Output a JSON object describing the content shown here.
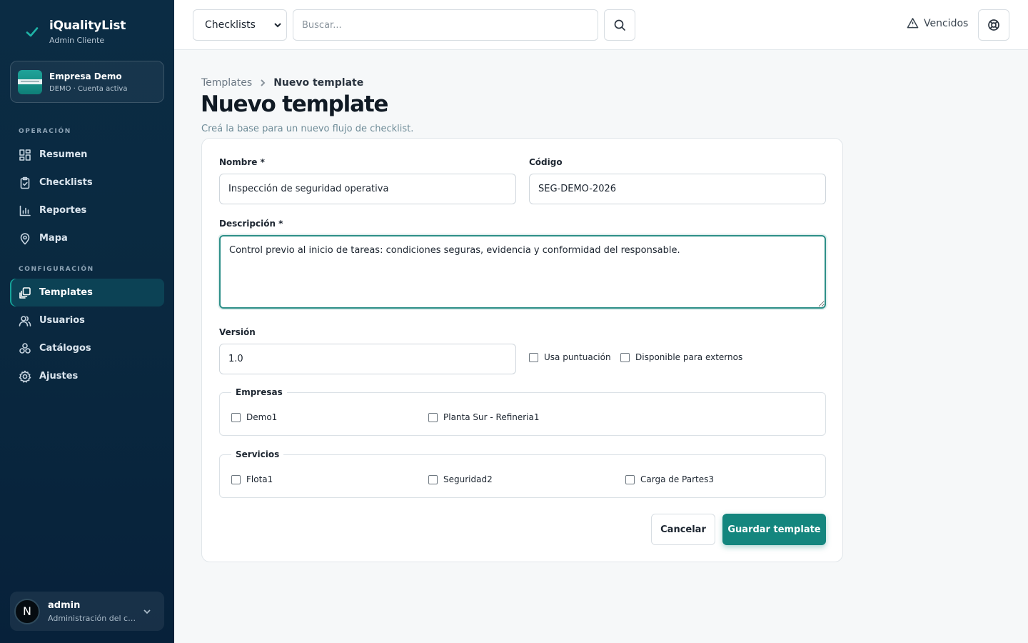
{
  "brand": {
    "title": "iQualityList",
    "subtitle": "Admin Cliente"
  },
  "company": {
    "name": "Empresa Demo",
    "status": "DEMO · Cuenta activa"
  },
  "sidebar": {
    "sections": [
      {
        "label": "OPERACIÓN",
        "items": [
          {
            "label": "Resumen",
            "icon": "grid-icon"
          },
          {
            "label": "Checklists",
            "icon": "clipboard-check-icon"
          },
          {
            "label": "Reportes",
            "icon": "bar-chart-icon"
          },
          {
            "label": "Mapa",
            "icon": "map-pin-icon"
          }
        ]
      },
      {
        "label": "CONFIGURACIÓN",
        "items": [
          {
            "label": "Templates",
            "icon": "templates-icon",
            "active": true
          },
          {
            "label": "Usuarios",
            "icon": "users-icon"
          },
          {
            "label": "Catálogos",
            "icon": "catalog-icon"
          },
          {
            "label": "Ajustes",
            "icon": "gear-icon"
          }
        ]
      }
    ]
  },
  "user": {
    "initial": "N",
    "name": "admin",
    "role": "Administración del cliente"
  },
  "topbar": {
    "select_value": "Checklists",
    "search_placeholder": "Buscar...",
    "overdue_label": "Vencidos"
  },
  "breadcrumb": {
    "parent": "Templates",
    "current": "Nuevo template"
  },
  "page": {
    "title": "Nuevo template",
    "subtitle": "Creá la base para un nuevo flujo de checklist."
  },
  "form": {
    "name_label": "Nombre *",
    "name_value": "Inspección de seguridad operativa",
    "code_label": "Código",
    "code_value": "SEG-DEMO-2026",
    "description_label": "Descripción *",
    "description_value": "Control previo al inicio de tareas: condiciones seguras, evidencia y conformidad del responsable.",
    "version_label": "Versión",
    "version_value": "1.0",
    "uses_score_label": "Usa puntuación",
    "external_label": "Disponible para externos",
    "companies": {
      "legend": "Empresas",
      "options": [
        "Demo1",
        "Planta Sur - Refineria1"
      ]
    },
    "services": {
      "legend": "Servicios",
      "options": [
        "Flota1",
        "Seguridad2",
        "Carga de Partes3"
      ]
    },
    "cancel_label": "Cancelar",
    "save_label": "Guardar template"
  },
  "colors": {
    "accent": "#14867e",
    "sidebar_bg": "#0b2c44",
    "focus_border": "#2d8f88"
  }
}
